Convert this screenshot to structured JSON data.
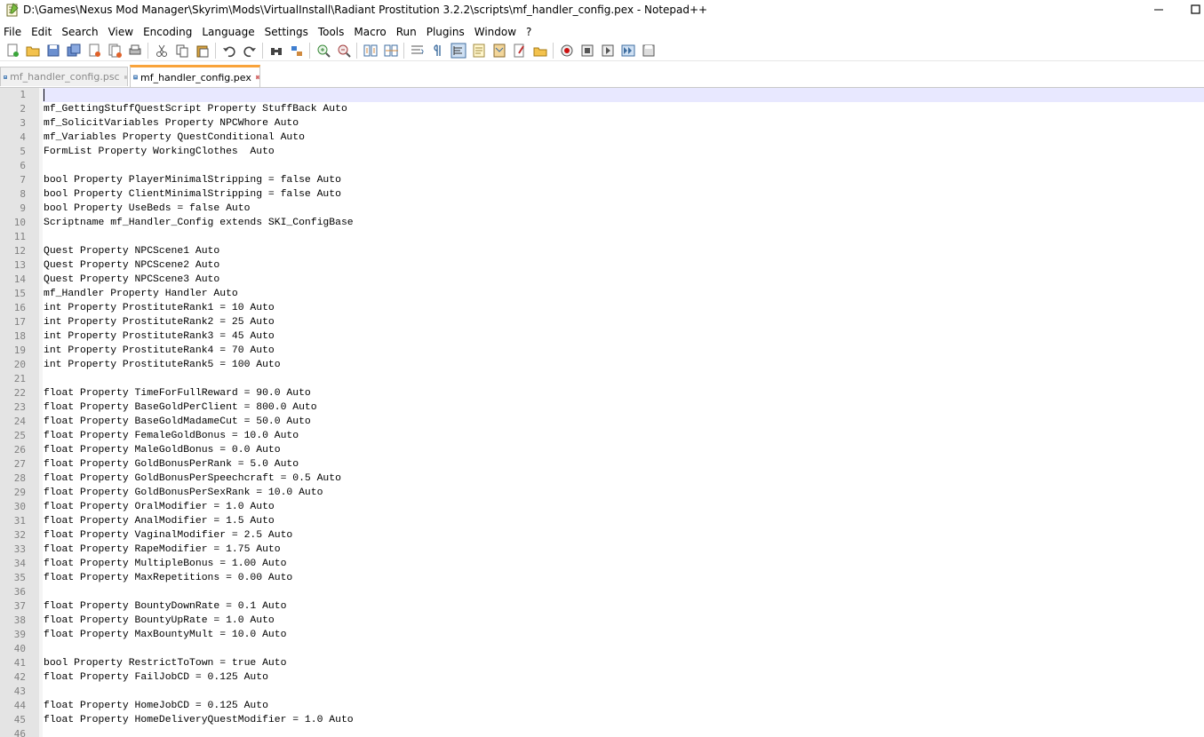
{
  "window": {
    "title": "D:\\Games\\Nexus Mod Manager\\Skyrim\\Mods\\VirtualInstall\\Radiant Prostitution 3.2.2\\scripts\\mf_handler_config.pex - Notepad++",
    "minimize_icon": "minimize-icon",
    "maximize_icon": "maximize-icon"
  },
  "menu": [
    "File",
    "Edit",
    "Search",
    "View",
    "Encoding",
    "Language",
    "Settings",
    "Tools",
    "Macro",
    "Run",
    "Plugins",
    "Window",
    "?"
  ],
  "toolbar": {
    "groups": [
      [
        "new-file-icon",
        "open-file-icon",
        "save-icon",
        "save-all-icon",
        "close-icon",
        "close-all-icon",
        "print-icon"
      ],
      [
        "cut-icon",
        "copy-icon",
        "paste-icon"
      ],
      [
        "undo-icon",
        "redo-icon"
      ],
      [
        "find-icon",
        "replace-icon"
      ],
      [
        "zoom-in-icon",
        "zoom-out-icon"
      ],
      [
        "sync-vertical-icon",
        "sync-horizontal-icon"
      ],
      [
        "word-wrap-icon",
        "show-all-chars-icon",
        "indent-guide-icon",
        "function-list-icon",
        "doc-map-icon",
        "folder-workspace-icon",
        "monitoring-icon"
      ],
      [
        "record-macro-icon",
        "stop-macro-icon",
        "play-macro-icon",
        "run-macro-multiple-icon",
        "save-macro-icon"
      ]
    ]
  },
  "tabs": [
    {
      "label": "mf_handler_config.psc",
      "active": false
    },
    {
      "label": "mf_handler_config.pex",
      "active": true
    }
  ],
  "colors": {
    "active_tab_accent": "#f9a33a",
    "current_line": "#e8e8ff",
    "gutter": "#e4e4e4",
    "line_number": "#808080"
  },
  "editor": {
    "lines": [
      "",
      "mf_GettingStuffQuestScript Property StuffBack Auto",
      "mf_SolicitVariables Property NPCWhore Auto",
      "mf_Variables Property QuestConditional Auto",
      "FormList Property WorkingClothes  Auto",
      "",
      "bool Property PlayerMinimalStripping = false Auto",
      "bool Property ClientMinimalStripping = false Auto",
      "bool Property UseBeds = false Auto",
      "Scriptname mf_Handler_Config extends SKI_ConfigBase",
      "",
      "Quest Property NPCScene1 Auto",
      "Quest Property NPCScene2 Auto",
      "Quest Property NPCScene3 Auto",
      "mf_Handler Property Handler Auto",
      "int Property ProstituteRank1 = 10 Auto",
      "int Property ProstituteRank2 = 25 Auto",
      "int Property ProstituteRank3 = 45 Auto",
      "int Property ProstituteRank4 = 70 Auto",
      "int Property ProstituteRank5 = 100 Auto",
      "",
      "float Property TimeForFullReward = 90.0 Auto",
      "float Property BaseGoldPerClient = 800.0 Auto",
      "float Property BaseGoldMadameCut = 50.0 Auto",
      "float Property FemaleGoldBonus = 10.0 Auto",
      "float Property MaleGoldBonus = 0.0 Auto",
      "float Property GoldBonusPerRank = 5.0 Auto",
      "float Property GoldBonusPerSpeechcraft = 0.5 Auto",
      "float Property GoldBonusPerSexRank = 10.0 Auto",
      "float Property OralModifier = 1.0 Auto",
      "float Property AnalModifier = 1.5 Auto",
      "float Property VaginalModifier = 2.5 Auto",
      "float Property RapeModifier = 1.75 Auto",
      "float Property MultipleBonus = 1.00 Auto",
      "float Property MaxRepetitions = 0.00 Auto",
      "",
      "float Property BountyDownRate = 0.1 Auto",
      "float Property BountyUpRate = 1.0 Auto",
      "float Property MaxBountyMult = 10.0 Auto",
      "",
      "bool Property RestrictToTown = true Auto",
      "float Property FailJobCD = 0.125 Auto",
      "",
      "float Property HomeJobCD = 0.125 Auto",
      "float Property HomeDeliveryQuestModifier = 1.0 Auto",
      ""
    ],
    "line_numbers": [
      "1",
      "2",
      "3",
      "4",
      "5",
      "6",
      "7",
      "8",
      "9",
      "10",
      "11",
      "12",
      "13",
      "14",
      "15",
      "16",
      "17",
      "18",
      "19",
      "20",
      "21",
      "22",
      "23",
      "24",
      "25",
      "26",
      "27",
      "28",
      "29",
      "30",
      "31",
      "32",
      "33",
      "34",
      "35",
      "36",
      "37",
      "38",
      "39",
      "40",
      "41",
      "42",
      "43",
      "44",
      "45",
      "46"
    ]
  }
}
